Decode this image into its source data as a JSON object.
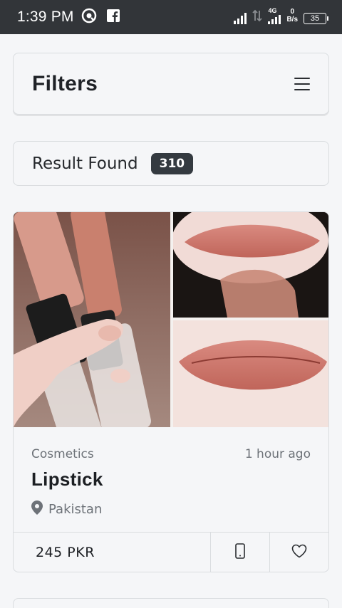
{
  "status_bar": {
    "time": "1:39 PM",
    "network": "4G",
    "speed_value": "0",
    "speed_unit": "B/s",
    "battery": "35",
    "icons": [
      "sync-icon",
      "facebook-icon",
      "signal-icon",
      "data-arrows-icon",
      "signal-4g-icon",
      "battery-icon"
    ]
  },
  "filters": {
    "title": "Filters",
    "menu_icon": "hamburger-menu-icon"
  },
  "results": {
    "label": "Result Found",
    "count": "310"
  },
  "listing": {
    "image_alt": "Lipstick product photo",
    "category": "Cosmetics",
    "time_ago": "1 hour ago",
    "title": "Lipstick",
    "location": "Pakistan",
    "price": "245 PKR",
    "actions": [
      "phone-icon",
      "heart-icon"
    ]
  },
  "colors": {
    "status_bar_bg": "#323539",
    "page_bg": "#f5f6f8",
    "badge_bg": "#343a40",
    "muted_text": "#6d7278"
  }
}
